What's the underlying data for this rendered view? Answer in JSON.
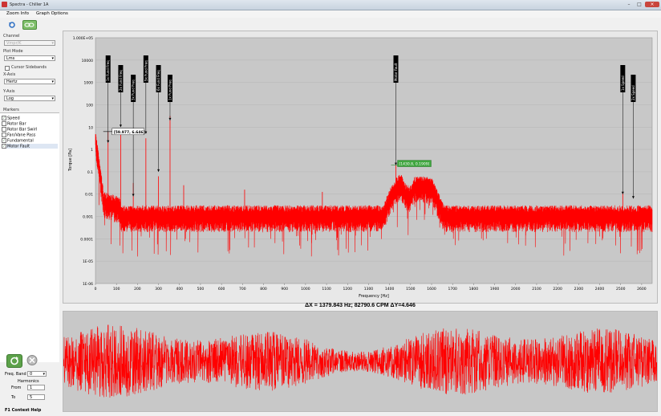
{
  "window": {
    "title": "Spectra - Chiller 1A",
    "minimize": "–",
    "maximize": "□",
    "close": "×"
  },
  "menu": [
    "Zoom Info",
    "Graph Options"
  ],
  "sidebar": {
    "channel_label": "Channel",
    "channel_value": "Vmpr/K",
    "plot_mode_label": "Plot Mode",
    "plot_mode_value": "Lms",
    "cursor_sidebands_label": "Cursor Sidebands",
    "x_axis_label": "X-Axis",
    "x_axis_value": "Hertz",
    "y_axis_label": "Y-Axis",
    "y_axis_value": "Log",
    "markers_label": "Markers",
    "markers": [
      {
        "label": "Speed",
        "checked": true
      },
      {
        "label": "Rotor Bar",
        "checked": false
      },
      {
        "label": "Rotor Bar Swirl",
        "checked": false
      },
      {
        "label": "Fan/Vane Pass",
        "checked": false
      },
      {
        "label": "Fundamental",
        "checked": true
      },
      {
        "label": "Motor Fault",
        "checked": true
      }
    ],
    "freq_band_label": "Freq. Band",
    "freq_band_value": "0",
    "harmonics_label": "Harmonics",
    "from_label": "From",
    "from_value": "1",
    "to_label": "To",
    "to_value": "5",
    "help_text": "F1 Context Help"
  },
  "spectrum": {
    "ylabel": "Torque [Pa]",
    "xlabel": "Frequency [Hz]",
    "cursor1_label": "[59.977, 6.646]",
    "cursor2_label": "[1430.8, 0.1909]",
    "markers": [
      {
        "label": "1x Fund Freq",
        "hz": 60,
        "tip_exp": 0.3
      },
      {
        "label": "2x Fund Freq",
        "hz": 120,
        "tip_exp": 1.0
      },
      {
        "label": "3x Fund Freq",
        "hz": 180,
        "tip_exp": -2.1
      },
      {
        "label": "5x Fund Freq",
        "hz": 240,
        "tip_exp": 0.7
      },
      {
        "label": "6x Fund Freq",
        "hz": 300,
        "tip_exp": -1.0
      },
      {
        "label": "1x Fund Freq",
        "hz": 355,
        "tip_exp": 1.3
      },
      {
        "label": "Motor Fault",
        "hz": 1430,
        "tip_exp": -0.7
      },
      {
        "label": "1x Speed",
        "hz": 2510,
        "tip_exp": -2.0
      },
      {
        "label": "2x Speed",
        "hz": 2560,
        "tip_exp": -2.2
      }
    ]
  },
  "delta_readout": "ΔX = 1379.843 Hz; 82790.6 CPM ΔY=4.646",
  "chart_data": {
    "type": "line",
    "xlabel": "Frequency [Hz]",
    "ylabel": "Torque [Pa]",
    "xlim": [
      0,
      2650
    ],
    "ylim_exp": [
      -6,
      5
    ],
    "y_scale": "log",
    "x_ticks": [
      0,
      100,
      200,
      300,
      400,
      500,
      600,
      700,
      800,
      900,
      1000,
      1100,
      1200,
      1300,
      1400,
      1500,
      1600,
      1700,
      1800,
      1900,
      2000,
      2100,
      2200,
      2300,
      2400,
      2500,
      2600
    ],
    "x_tick_labels": [
      "0",
      "100",
      "200",
      "300",
      "400",
      "500",
      "600",
      "700",
      "800",
      "900",
      "1000",
      "1100",
      "1200",
      "1300",
      "1400",
      "1500",
      "1600",
      "1700",
      "1800",
      "1900",
      "2000",
      "2100",
      "2200",
      "2300",
      "2400",
      "2500",
      "2600"
    ],
    "y_tick_exps": [
      5,
      4,
      3,
      2,
      1,
      0,
      -1,
      -2,
      -3,
      -4,
      -5,
      -6
    ],
    "y_tick_labels": [
      "1.000E+05",
      "10000",
      "1000",
      "100",
      "10",
      "1",
      "0.1",
      "0.01",
      "0.001",
      "0.0001",
      "1E-05",
      "1E-06"
    ],
    "series_color": "#ff0000",
    "peaks": [
      {
        "hz": 60,
        "exp": 0.8
      },
      {
        "hz": 120,
        "exp": 0.9
      },
      {
        "hz": 180,
        "exp": -1.5
      },
      {
        "hz": 240,
        "exp": 0.5
      },
      {
        "hz": 300,
        "exp": -1.2
      },
      {
        "hz": 355,
        "exp": 1.5
      },
      {
        "hz": 420,
        "exp": -1.6
      },
      {
        "hz": 710,
        "exp": -1.8
      },
      {
        "hz": 1080,
        "exp": -1.9
      },
      {
        "hz": 1430,
        "exp": -0.7
      },
      {
        "hz": 2510,
        "exp": -1.9
      }
    ]
  }
}
